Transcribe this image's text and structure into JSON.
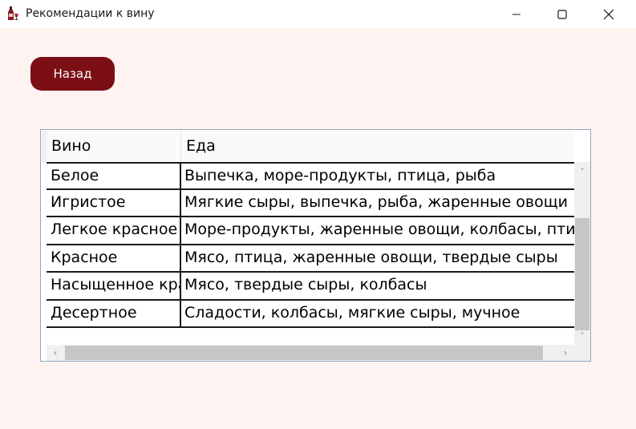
{
  "window": {
    "title": "Рекомендации к вину",
    "icons": {
      "app": "wine-bottle-glass-icon",
      "minimize": "minimize-icon",
      "maximize": "maximize-icon",
      "close": "close-icon"
    }
  },
  "back_button": {
    "label": "Назад",
    "color": "#7b0f15"
  },
  "table": {
    "columns": [
      "Вино",
      "Еда"
    ],
    "rows": [
      {
        "wine": "Белое",
        "food": "Выпечка, море-продукты, птица, рыба"
      },
      {
        "wine": "Игристое",
        "food": "Мягкие сыры, выпечка, рыба, жаренные овощи"
      },
      {
        "wine": "Легкое красное",
        "food": "Море-продукты, жаренные овощи, колбасы, птица"
      },
      {
        "wine": "Красное",
        "food": "Мясо, птица, жаренные овощи, твердые сыры"
      },
      {
        "wine": "Насыщенное красное",
        "food": "Мясо, твердые сыры, колбасы"
      },
      {
        "wine": "Десертное",
        "food": "Сладости, колбасы, мягкие сыры, мучное"
      }
    ],
    "scrollbars": {
      "arrow_icons": [
        "scroll-up-icon",
        "scroll-down-icon",
        "scroll-left-icon",
        "scroll-right-icon"
      ]
    }
  }
}
